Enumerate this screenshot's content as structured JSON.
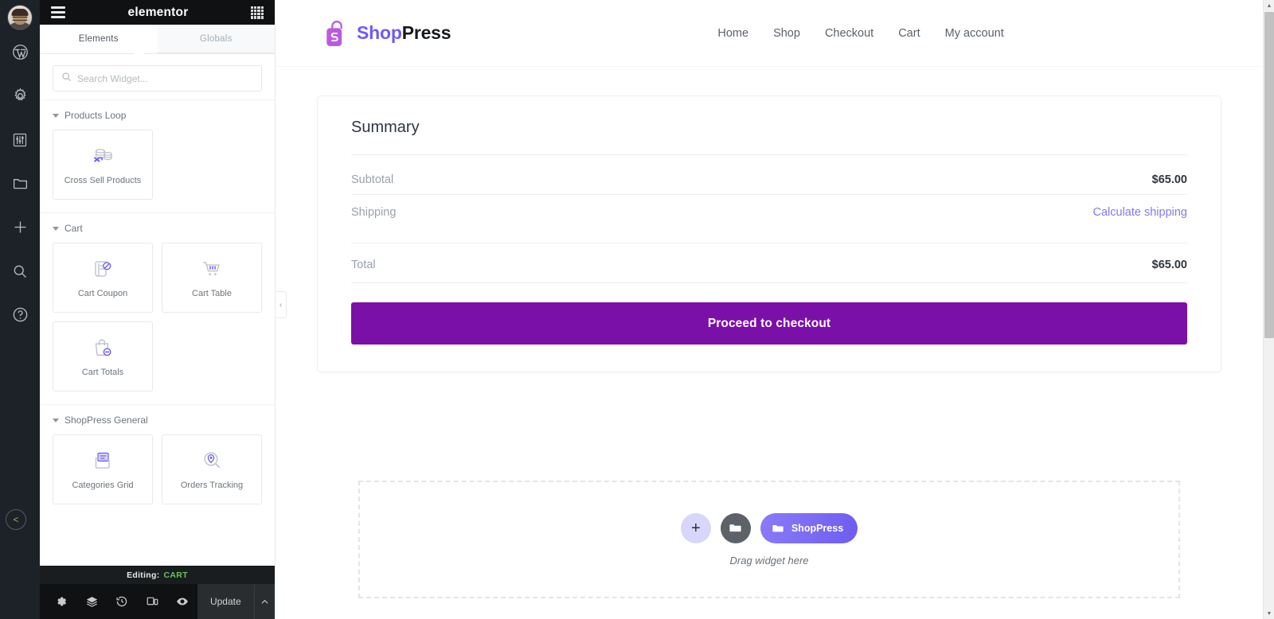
{
  "wp_rail": {
    "avatar_label": "User avatar",
    "items": [
      {
        "name": "wordpress-icon",
        "label": "WordPress"
      },
      {
        "name": "gear-icon",
        "label": "Settings"
      },
      {
        "name": "sliders-icon",
        "label": "Customize"
      },
      {
        "name": "folder-icon",
        "label": "Templates"
      },
      {
        "name": "plus-icon",
        "label": "New"
      },
      {
        "name": "search-icon",
        "label": "Search"
      },
      {
        "name": "help-icon",
        "label": "Help"
      }
    ],
    "collapse_label": "<"
  },
  "panel": {
    "header": {
      "menu_icon": "hamburger-icon",
      "brand": "elementor",
      "apps_icon": "grid-dots-icon"
    },
    "tabs": [
      {
        "label": "Elements",
        "active": true
      },
      {
        "label": "Globals",
        "active": false
      }
    ],
    "search": {
      "placeholder": "Search Widget...",
      "value": "",
      "icon": "search-icon"
    },
    "categories": [
      {
        "title": "Products Loop",
        "widgets": [
          {
            "label": "Cross Sell Products",
            "icon": "cross-sell-products-icon"
          }
        ]
      },
      {
        "title": "Cart",
        "widgets": [
          {
            "label": "Cart Coupon",
            "icon": "cart-coupon-icon"
          },
          {
            "label": "Cart Table",
            "icon": "cart-table-icon"
          },
          {
            "label": "Cart Totals",
            "icon": "cart-totals-icon"
          }
        ]
      },
      {
        "title": "ShopPress General",
        "widgets": [
          {
            "label": "Categories Grid",
            "icon": "categories-grid-icon"
          },
          {
            "label": "Orders Tracking",
            "icon": "orders-tracking-icon"
          }
        ]
      }
    ],
    "collapse_arrow": "‹",
    "editing": {
      "prefix": "Editing:",
      "target": "CART"
    },
    "footer": {
      "icons": [
        {
          "name": "settings-gear-icon",
          "label": "Page Settings"
        },
        {
          "name": "navigator-layers-icon",
          "label": "Navigator"
        },
        {
          "name": "history-icon",
          "label": "History"
        },
        {
          "name": "responsive-icon",
          "label": "Responsive Mode"
        },
        {
          "name": "preview-eye-icon",
          "label": "Preview Changes"
        }
      ],
      "update_label": "Update",
      "caret": "⌃"
    }
  },
  "site": {
    "logo": {
      "shop": "Shop",
      "press": "Press"
    },
    "nav": [
      {
        "label": "Home"
      },
      {
        "label": "Shop"
      },
      {
        "label": "Checkout"
      },
      {
        "label": "Cart"
      },
      {
        "label": "My account"
      }
    ]
  },
  "summary": {
    "title": "Summary",
    "rows": [
      {
        "key": "Subtotal",
        "value": "$65.00",
        "type": "value"
      },
      {
        "key": "Shipping",
        "value": "Calculate shipping",
        "type": "link"
      },
      {
        "key": "Total",
        "value": "$65.00",
        "type": "value"
      }
    ],
    "checkout_button": "Proceed to checkout"
  },
  "dropzone": {
    "add_icon": "plus-icon",
    "folder_icon": "folder-icon",
    "shoppress_label": "ShopPress",
    "shoppress_icon": "folder-icon",
    "hint": "Drag widget here"
  },
  "scrollbar": {
    "up_arrow": "▲",
    "down_arrow": "▼"
  },
  "colors": {
    "elementor_dark": "#0f1112",
    "wp_rail": "#1d2228",
    "brand_purple": "#6f5af6",
    "checkout_purple": "#7b10a8",
    "link_purple": "#7f7bf0",
    "editing_green": "#6ac259"
  }
}
